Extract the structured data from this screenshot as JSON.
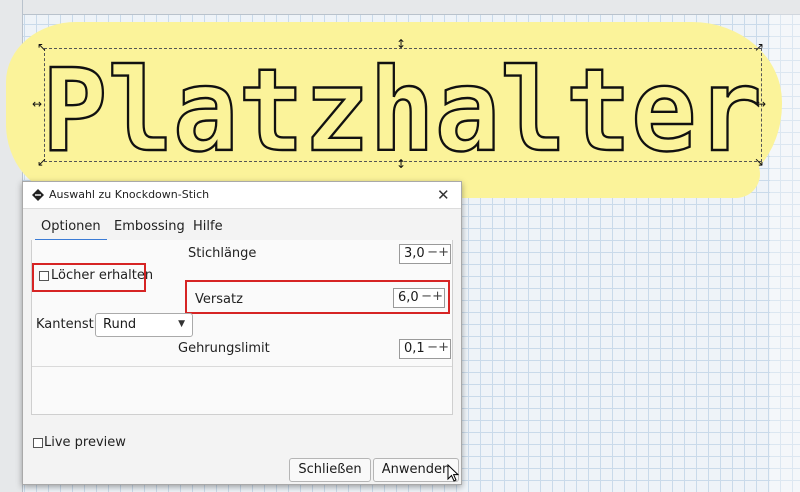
{
  "canvas": {
    "artwork_text": "Platzhalter",
    "highlight_color": "#fbf39a"
  },
  "dialog": {
    "title": "Auswahl zu Knockdown-Stich",
    "tabs": [
      {
        "label": "Optionen",
        "active": true
      },
      {
        "label": "Embossing",
        "active": false
      },
      {
        "label": "Hilfe",
        "active": false
      }
    ],
    "fields": {
      "stichlaenge": {
        "label": "Stichlänge",
        "value": "3,0"
      },
      "loecher": {
        "label": "Löcher erhalten",
        "checked": false
      },
      "versatz": {
        "label": "Versatz",
        "value": "6,0"
      },
      "kantenstil": {
        "label": "Kantenstil",
        "value": "Rund"
      },
      "gehrungslimit": {
        "label": "Gehrungslimit",
        "value": "0,1"
      }
    },
    "live_preview": {
      "label": "Live preview",
      "checked": false
    },
    "buttons": {
      "close": "Schließen",
      "apply": "Anwenden"
    },
    "spin_minus": "−",
    "spin_plus": "+",
    "highlight_color": "#d62424"
  }
}
